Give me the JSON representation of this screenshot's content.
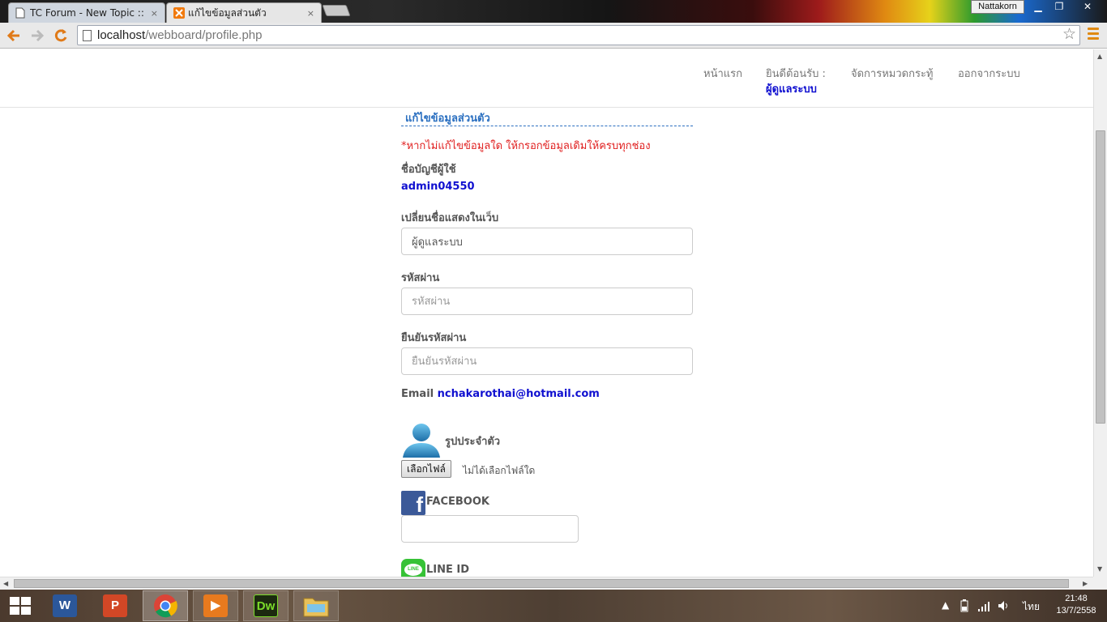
{
  "browser": {
    "tabs": [
      {
        "title": "TC Forum - New Topic :: ห้",
        "close": "×"
      },
      {
        "title": "แก้ไขข้อมูลส่วนตัว",
        "close": "×"
      }
    ],
    "user_badge": "Nattakorn",
    "window_controls": {
      "minimize": "▁",
      "restore": "❐",
      "close": "✕"
    },
    "url_host": "localhost",
    "url_path": "/webboard/profile.php"
  },
  "nav": {
    "home": "หน้าแรก",
    "welcome": "ยินดีต้อนรับ :",
    "welcome_user": "ผู้ดูแลระบบ",
    "manage_categories": "จัดการหมวดกระทู้",
    "logout": "ออกจากระบบ"
  },
  "profile": {
    "title": "แก้ไขข้อมูลส่วนตัว",
    "warning": "*หากไม่แก้ไขข้อมูลใด ให้กรอกข้อมูลเดิมให้ครบทุกช่อง",
    "account_label": "ชื่อบัญชีผู้ใช้",
    "account_value": "admin04550",
    "display_name_label": "เปลี่ยนชื่อแสดงในเว็บ",
    "display_name_value": "ผู้ดูแลระบบ",
    "password_label": "รหัสผ่าน",
    "password_placeholder": "รหัสผ่าน",
    "confirm_label": "ยืนยันรหัสผ่าน",
    "confirm_placeholder": "ยืนยันรหัสผ่าน",
    "email_label": "Email",
    "email_value": "nchakarothai@hotmail.com",
    "avatar_label": "รูปประจำตัว",
    "file_button": "เลือกไฟล์",
    "file_status": "ไม่ได้เลือกไฟล์ใด",
    "facebook_label": "FACEBOOK",
    "facebook_value": "",
    "line_label": "LINE ID",
    "line_icon_text": "LINE"
  },
  "taskbar": {
    "apps": [
      {
        "name": "word",
        "glyph": "W",
        "color": "#2b579a"
      },
      {
        "name": "powerpoint",
        "glyph": "P",
        "color": "#d24726"
      },
      {
        "name": "chrome",
        "glyph": "",
        "color": "#ffffff"
      },
      {
        "name": "media-player",
        "glyph": "▶",
        "color": "#e87a1e"
      },
      {
        "name": "dreamweaver",
        "glyph": "Dw",
        "color": "#1c2a10"
      },
      {
        "name": "file-explorer",
        "glyph": "",
        "color": "#e8c15a"
      }
    ],
    "language": "ไทย",
    "time": "21:48",
    "date": "13/7/2558"
  }
}
